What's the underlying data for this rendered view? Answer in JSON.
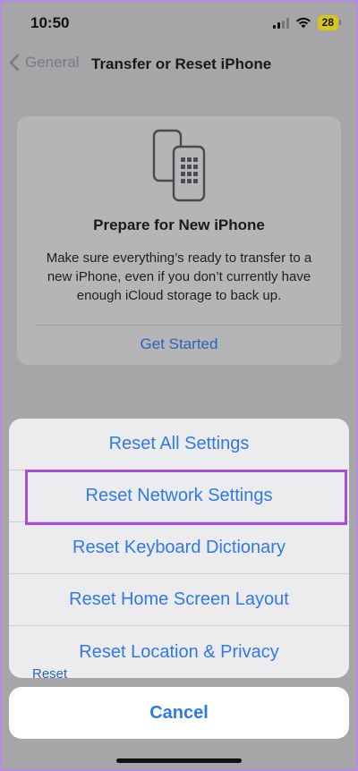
{
  "status_bar": {
    "time": "10:50",
    "battery": "28"
  },
  "nav": {
    "back_label": "General",
    "title": "Transfer or Reset iPhone"
  },
  "prepare": {
    "title": "Prepare for New iPhone",
    "description": "Make sure everything’s ready to transfer to a new iPhone, even if you don’t currently have enough iCloud storage to back up.",
    "link": "Get Started"
  },
  "peek_text": "Reset",
  "action_sheet": {
    "items": [
      "Reset All Settings",
      "Reset Network Settings",
      "Reset Keyboard Dictionary",
      "Reset Home Screen Layout",
      "Reset Location & Privacy"
    ],
    "highlighted_item": "Reset Network Settings",
    "cancel": "Cancel"
  },
  "colors": {
    "accent": "#2f7ae5",
    "highlight": "#a64ce0",
    "battery": "#d9c51a"
  }
}
